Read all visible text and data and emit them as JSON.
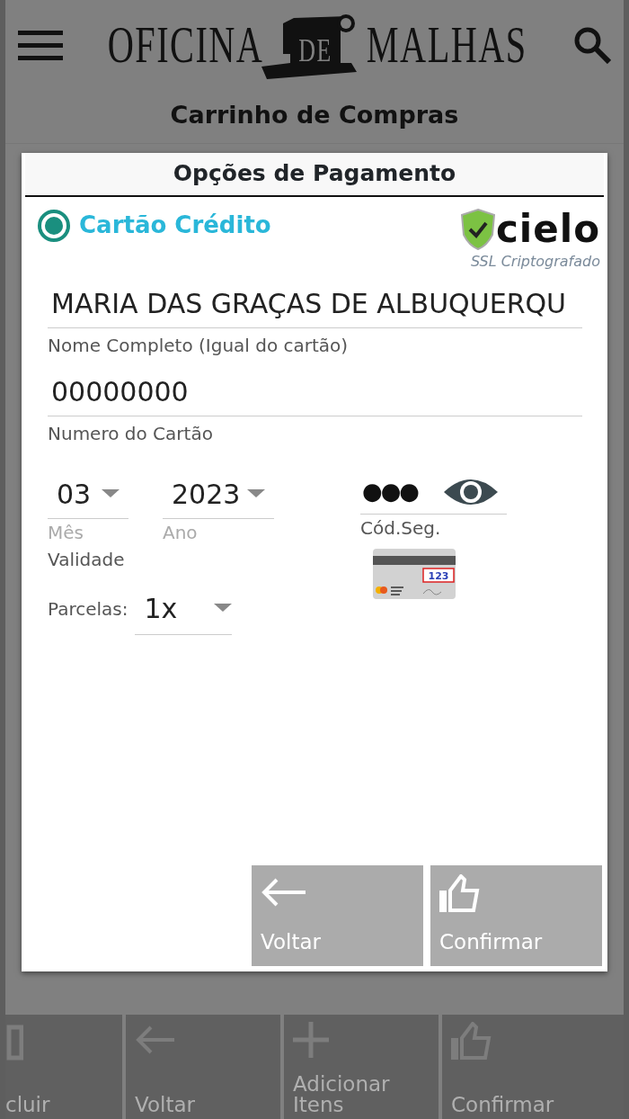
{
  "header": {
    "logo": [
      "OFICINA",
      "DE",
      "MALHAS"
    ]
  },
  "page_title": "Carrinho de Compras",
  "dialog": {
    "title": "Opções de Pagamento",
    "payment_options": [
      {
        "label": "Cartão Crédito",
        "selected": true
      }
    ],
    "badge": {
      "brand": "cielo",
      "caption": "SSL Criptografado"
    },
    "name_field": {
      "value": "MARIA DAS GRAÇAS DE ALBUQUERQU",
      "label": "Nome Completo (Igual do cartão)"
    },
    "number_field": {
      "value": "00000000",
      "label": "Numero do Cartão"
    },
    "month": {
      "value": "03",
      "label": "Mês"
    },
    "year": {
      "value": "2023",
      "label": "Ano"
    },
    "validity_label": "Validade",
    "security_code": {
      "value": "●●●",
      "label": "Cód.Seg.",
      "card_code": "123"
    },
    "installments": {
      "label": "Parcelas:",
      "value": "1x"
    },
    "buttons": [
      {
        "kind": "back",
        "label": "Voltar"
      },
      {
        "kind": "confirm",
        "label": "Confirmar"
      }
    ]
  },
  "bottom_bar": [
    {
      "kind": "delete",
      "label": "cluir"
    },
    {
      "kind": "back",
      "label": "Voltar"
    },
    {
      "kind": "add",
      "label": "Adicionar Itens"
    },
    {
      "kind": "confirm",
      "label": "Confirmar"
    }
  ]
}
